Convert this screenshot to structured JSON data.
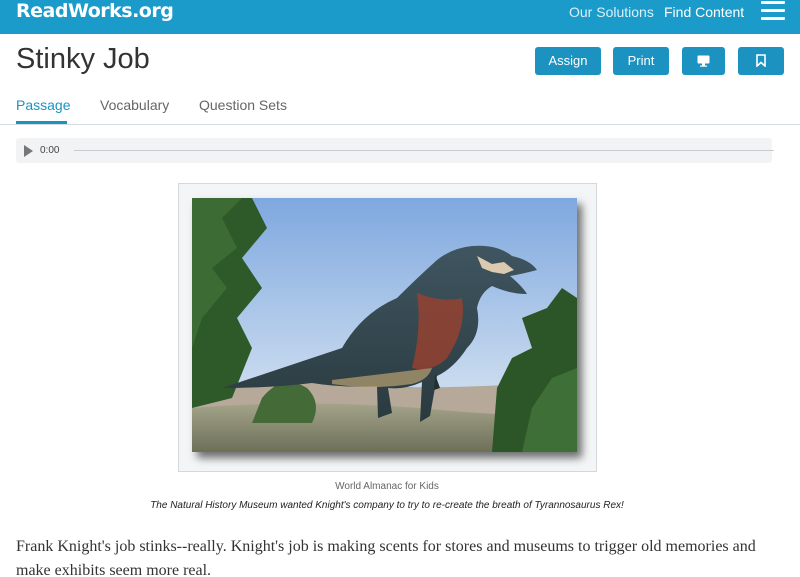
{
  "header": {
    "logo_main": "ReadWorks",
    "logo_org": ".org",
    "nav": {
      "our_solutions": "Our Solutions",
      "find_content": "Find Content"
    },
    "menu_icon": "hamburger-menu-icon",
    "background_color": "#1b9bc9"
  },
  "article": {
    "title": "Stinky Job",
    "actions": {
      "assign_label": "Assign",
      "print_label": "Print",
      "present_icon": "monitor-icon",
      "bookmark_icon": "bookmark-icon"
    }
  },
  "tabs": {
    "passage": "Passage",
    "vocabulary": "Vocabulary",
    "question_sets": "Question Sets",
    "active": "Passage"
  },
  "audio": {
    "time": "0:00",
    "play_icon": "play-icon"
  },
  "figure": {
    "credit": "World Almanac for Kids",
    "caption": "The Natural History Museum wanted Knight's company to try to re-create the breath of Tyrannosaurus Rex!"
  },
  "passage": {
    "text": "Frank Knight's job stinks--really. Knight's job is making scents for stores and museums to trigger old memories and make exhibits seem more real."
  },
  "colors": {
    "accent": "#1b92c0",
    "text": "#333333"
  }
}
